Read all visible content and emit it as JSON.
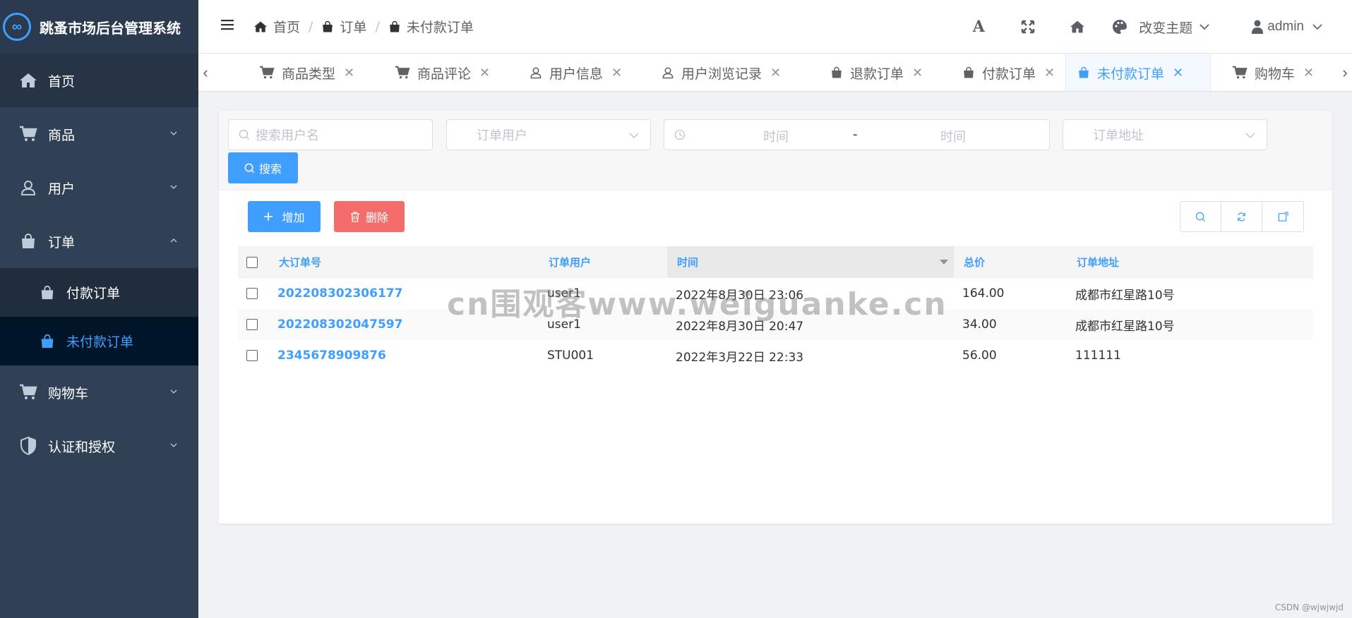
{
  "app": {
    "title": "跳蚤市场后台管理系统",
    "logo_glyph": "∞"
  },
  "sidebar": {
    "items": [
      {
        "label": "首页",
        "icon": "home-icon"
      },
      {
        "label": "商品",
        "icon": "cart-icon"
      },
      {
        "label": "用户",
        "icon": "user-icon"
      },
      {
        "label": "订单",
        "icon": "bag-icon"
      },
      {
        "label": "购物车",
        "icon": "cart-icon"
      },
      {
        "label": "认证和授权",
        "icon": "shield-icon"
      }
    ],
    "order_sub": [
      {
        "label": "付款订单",
        "icon": "bag-icon"
      },
      {
        "label": "未付款订单",
        "icon": "bag-icon"
      }
    ]
  },
  "breadcrumb": [
    "首页",
    "订单",
    "未付款订单"
  ],
  "breadcrumb_sep": "/",
  "navbar": {
    "theme_label": "改变主题",
    "user_name": "admin",
    "font_glyph": "A"
  },
  "tags": [
    {
      "label": "商品类型"
    },
    {
      "label": "商品评论"
    },
    {
      "label": "用户信息"
    },
    {
      "label": "用户浏览记录"
    },
    {
      "label": "退款订单"
    },
    {
      "label": "付款订单"
    },
    {
      "label": "未付款订单",
      "active": true
    },
    {
      "label": "购物车"
    }
  ],
  "tag_close": "✕",
  "tag_arrows": {
    "left": "‹",
    "right": "›"
  },
  "search": {
    "username_placeholder": "搜索用户名",
    "order_user_placeholder": "订单用户",
    "time_start_placeholder": "时间",
    "time_sep": "-",
    "time_end_placeholder": "时间",
    "address_placeholder": "订单地址",
    "search_button": "搜索"
  },
  "toolbar": {
    "add_button": "增加",
    "delete_button": "删除"
  },
  "table": {
    "headers": [
      "大订单号",
      "订单用户",
      "时间",
      "总价",
      "订单地址"
    ],
    "rows": [
      {
        "order_no": "202208302306177",
        "user": "user1",
        "time": "2022年8月30日 23:06",
        "total": "164.00",
        "address": "成都市红星路10号"
      },
      {
        "order_no": "202208302047597",
        "user": "user1",
        "time": "2022年8月30日 20:47",
        "total": "34.00",
        "address": "成都市红星路10号"
      },
      {
        "order_no": "2345678909876",
        "user": "STU001",
        "time": "2022年3月22日 22:33",
        "total": "56.00",
        "address": "111111"
      }
    ]
  },
  "watermark": "cn围观客www.weiguanke.cn",
  "footer_credit": "CSDN @wjwjwjd",
  "colors": {
    "sidebar_bg": "#304156",
    "accent": "#409eff",
    "danger": "#f56c6c",
    "active_sub_bg": "#001528"
  }
}
